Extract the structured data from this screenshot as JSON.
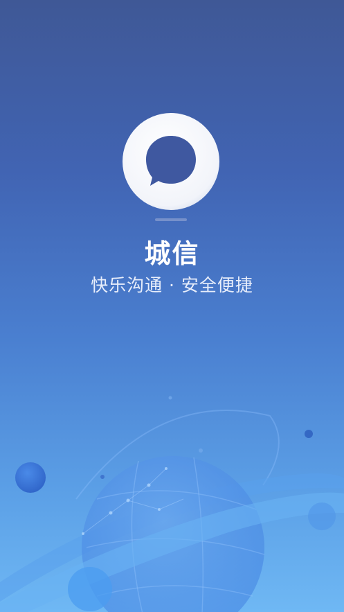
{
  "app": {
    "name": "城信",
    "tagline": "快乐沟通 · 安全便捷"
  },
  "icons": {
    "logo": "chat-bubble-ring-logo",
    "illustration": "planet-with-orbit-ring"
  },
  "colors": {
    "background_top": "#3f5896",
    "background_bottom": "#6fb8f4",
    "logo_ring": "#f4f6fb",
    "text": "#ffffff"
  }
}
